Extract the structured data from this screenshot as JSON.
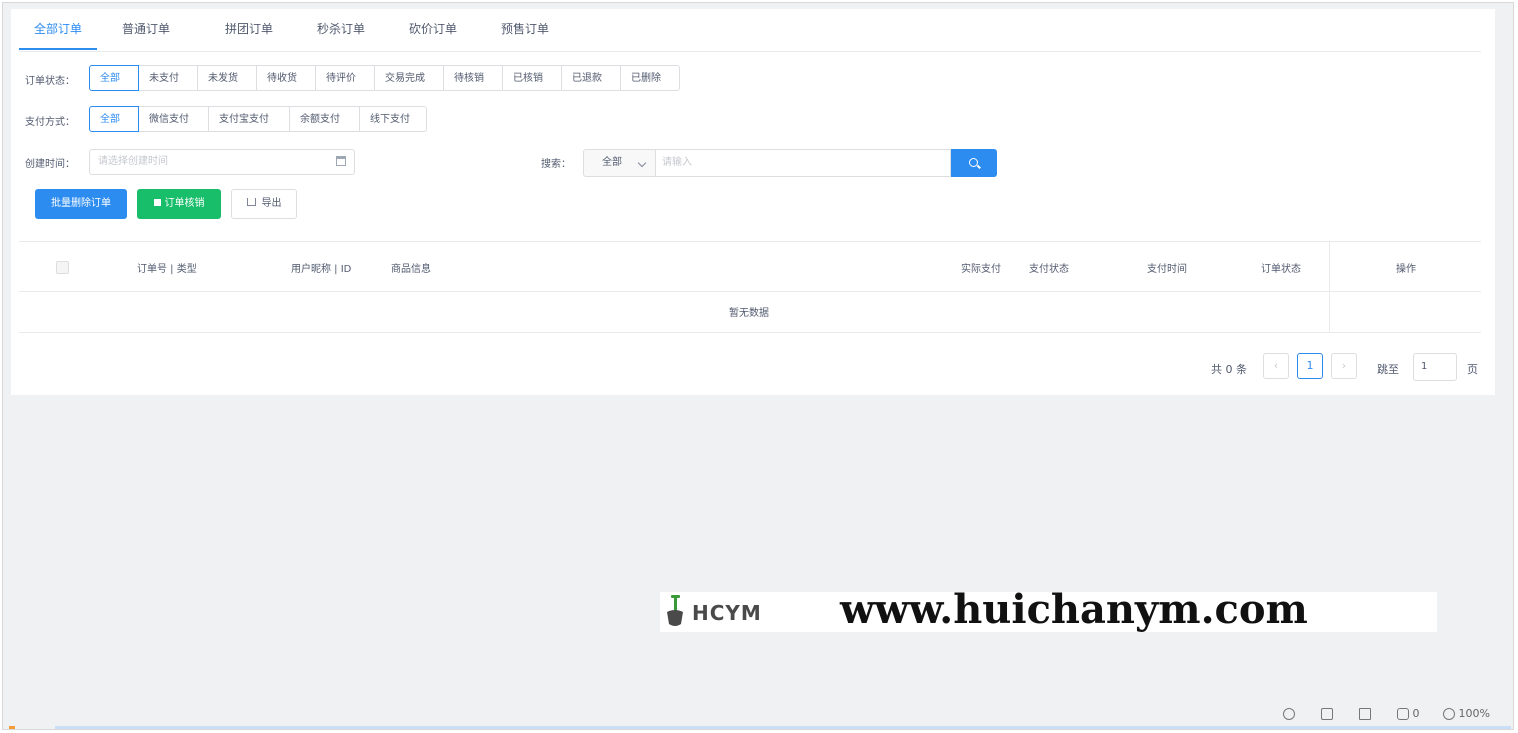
{
  "tabs": [
    "全部订单",
    "普通订单",
    "拼团订单",
    "秒杀订单",
    "砍价订单",
    "预售订单"
  ],
  "filters": {
    "status_label": "订单状态：",
    "status_options": [
      "全部",
      "未支付",
      "未发货",
      "待收货",
      "待评价",
      "交易完成",
      "待核销",
      "已核销",
      "已退款",
      "已删除"
    ],
    "payment_label": "支付方式：",
    "payment_options": [
      "全部",
      "微信支付",
      "支付宝支付",
      "余额支付",
      "线下支付"
    ],
    "date_label": "创建时间：",
    "date_placeholder": "请选择创建时间",
    "search_label": "搜索：",
    "search_select_value": "全部",
    "search_placeholder": "请输入"
  },
  "actions": {
    "batch_delete": "批量删除订单",
    "verify": "订单核销",
    "export": "导出"
  },
  "table": {
    "columns": [
      "订单号 | 类型",
      "用户昵称 | ID",
      "商品信息",
      "实际支付",
      "支付状态",
      "支付时间",
      "订单状态",
      "操作"
    ],
    "empty_text": "暂无数据"
  },
  "pagination": {
    "total_text": "共 0 条",
    "current_page": "1",
    "jump_label": "跳至",
    "jump_value": "1",
    "page_suffix": "页"
  },
  "watermark": {
    "brand": "HCYM",
    "url": "www.huichanym.com"
  },
  "statusbar": {
    "badge_count": "0",
    "zoom": "100%"
  },
  "colors": {
    "primary": "#2d8cf0",
    "success": "#19be6b"
  }
}
